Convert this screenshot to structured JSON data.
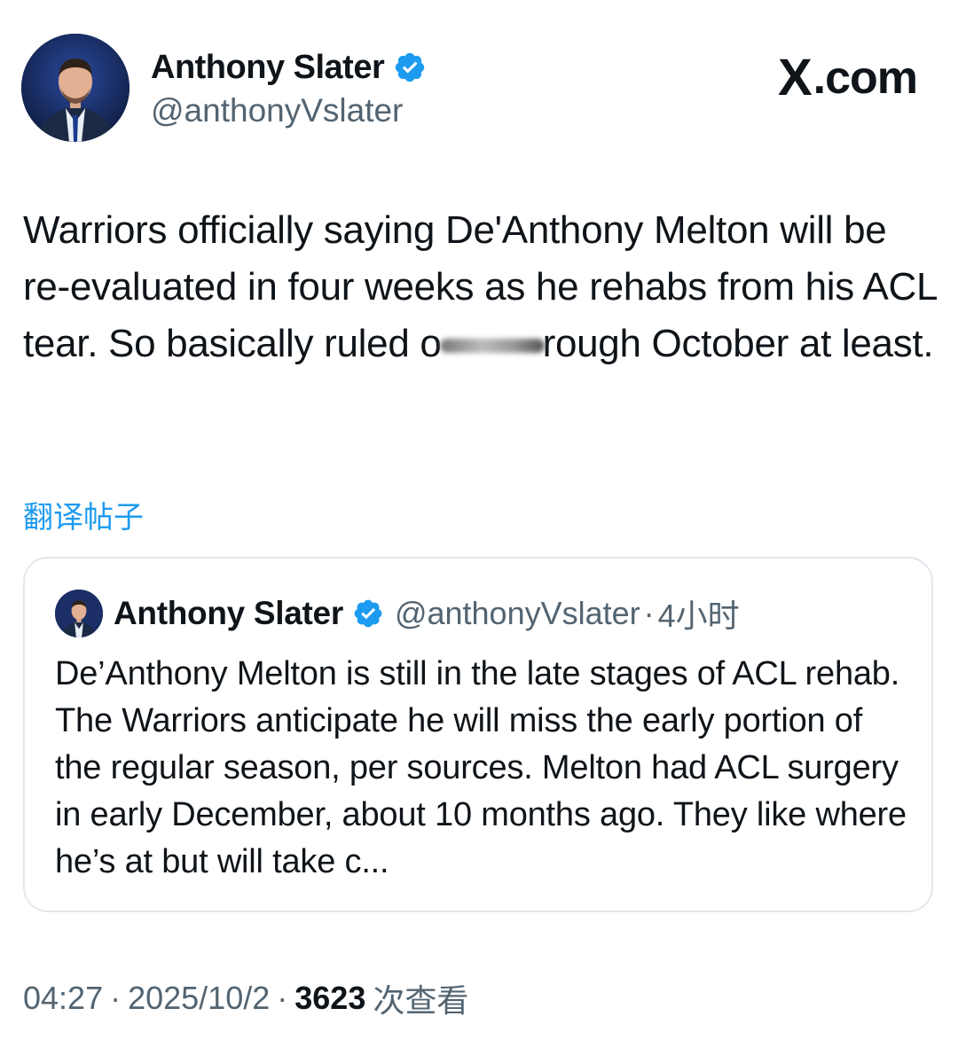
{
  "author": {
    "display_name": "Anthony Slater",
    "handle": "@anthonyVslater",
    "verified": true
  },
  "brand": {
    "logo_text": "X",
    "domain_text": ".com"
  },
  "tweet": {
    "text_before_blur": "Warriors officially saying De'Anthony Melton will be re-evaluated in four weeks as he rehabs from his ACL tear. So basically ruled o",
    "text_after_blur": "rough October at least."
  },
  "translate_label": "翻译帖子",
  "quoted_tweet": {
    "display_name": "Anthony Slater",
    "handle": "@anthonyVslater",
    "separator": "·",
    "time": "4小时",
    "text": "De’Anthony Melton is still in the late stages of ACL rehab. The Warriors anticipate he will miss the early portion of the regular season, per sources. Melton had ACL surgery in early December, about 10 months ago. They like where he’s at but will take c..."
  },
  "meta": {
    "time": "04:27",
    "separator": "·",
    "date": "2025/10/2",
    "views_count": "3623",
    "views_label": "次查看"
  },
  "colors": {
    "accent": "#1d9bf0",
    "text_primary": "#0f1419",
    "text_secondary": "#536471",
    "border": "#e1e8ed",
    "verified_badge": "#1d9bf0"
  },
  "icons": [
    "verified-badge-icon",
    "x-logo-icon"
  ]
}
